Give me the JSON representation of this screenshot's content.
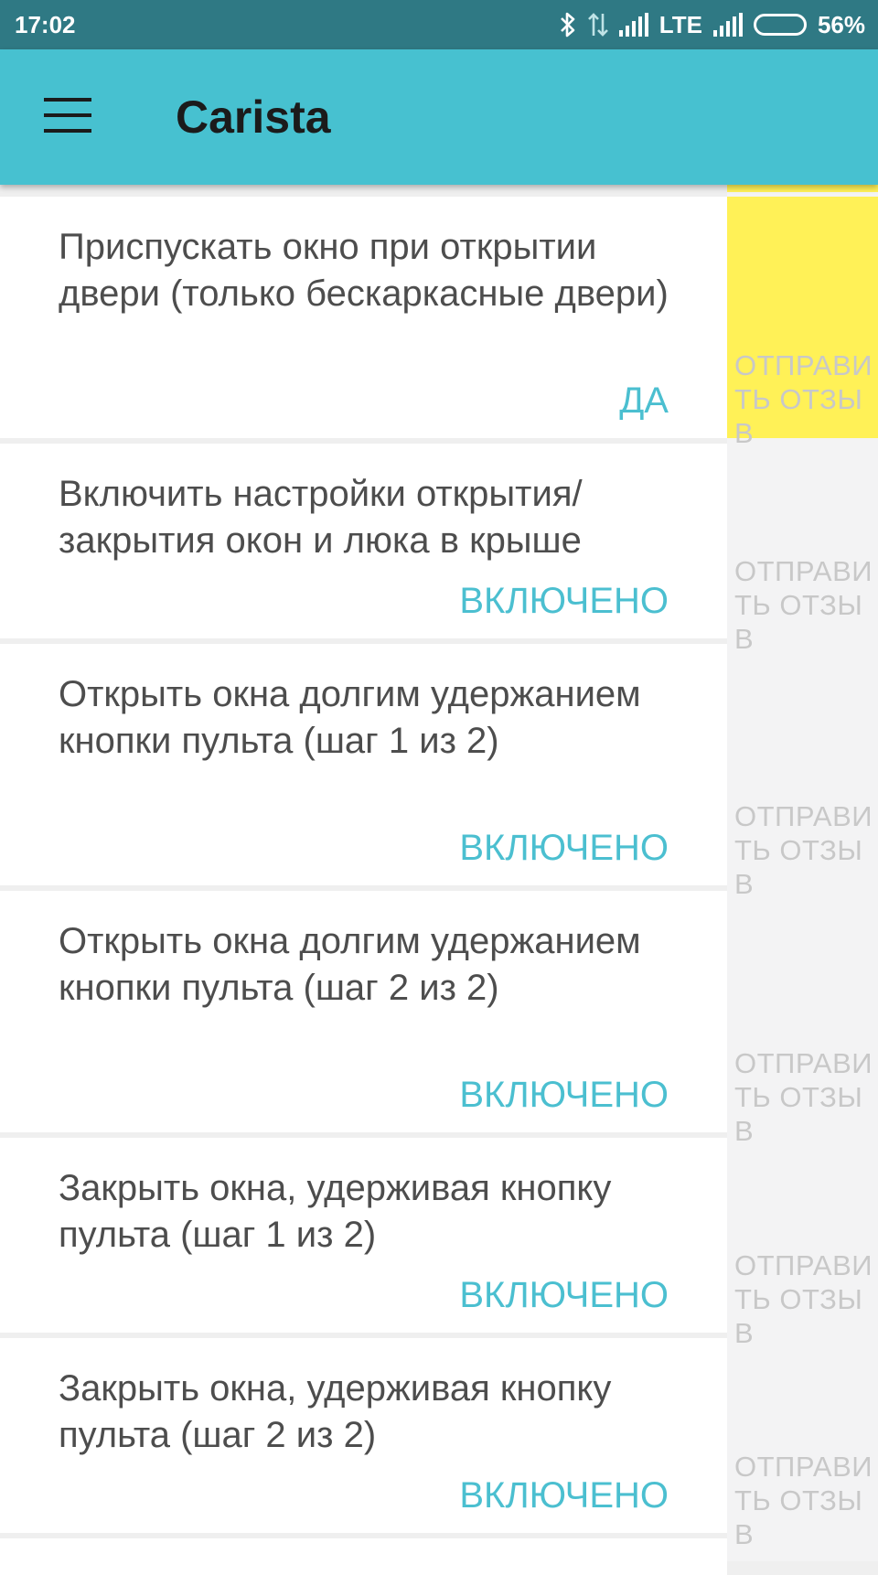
{
  "status_bar": {
    "time": "17:02",
    "network": "LTE",
    "battery": "56%",
    "battery_level": 0.56
  },
  "app_bar": {
    "menu_icon": "hamburger-menu-icon",
    "title": "Carista"
  },
  "colors": {
    "status_bar": "#2f7984",
    "app_bar": "#47c1d0",
    "value_text": "#4bbfd0",
    "highlight": "#fff157",
    "feedback_text": "#c8c8c8"
  },
  "settings": [
    {
      "title": "Приспускать окно при открытии двери (только бескаркасные двери)",
      "value": "ДА",
      "feedback": "ОТПРАВИТЬ ОТЗЫВ",
      "highlighted": true
    },
    {
      "title": "Включить настройки открытия/ закрытия окон и люка в крыше",
      "value": "ВКЛЮЧЕНО",
      "feedback": "ОТПРАВИТЬ ОТЗЫВ",
      "highlighted": false
    },
    {
      "title": "Открыть окна долгим удержанием кнопки пульта (шаг 1 из 2)",
      "value": "ВКЛЮЧЕНО",
      "feedback": "ОТПРАВИТЬ ОТЗЫВ",
      "highlighted": false
    },
    {
      "title": "Открыть окна долгим удержанием кнопки пульта (шаг 2 из 2)",
      "value": "ВКЛЮЧЕНО",
      "feedback": "ОТПРАВИТЬ ОТЗЫВ",
      "highlighted": false
    },
    {
      "title": "Закрыть окна, удерживая кнопку пульта (шаг 1 из 2)",
      "value": "ВКЛЮЧЕНО",
      "feedback": "ОТПРАВИТЬ ОТЗЫВ",
      "highlighted": false
    },
    {
      "title": "Закрыть окна, удерживая кнопку пульта (шаг 2 из 2)",
      "value": "ВКЛЮЧЕНО",
      "feedback": "ОТПРАВИТЬ ОТЗЫВ",
      "highlighted": false
    }
  ]
}
